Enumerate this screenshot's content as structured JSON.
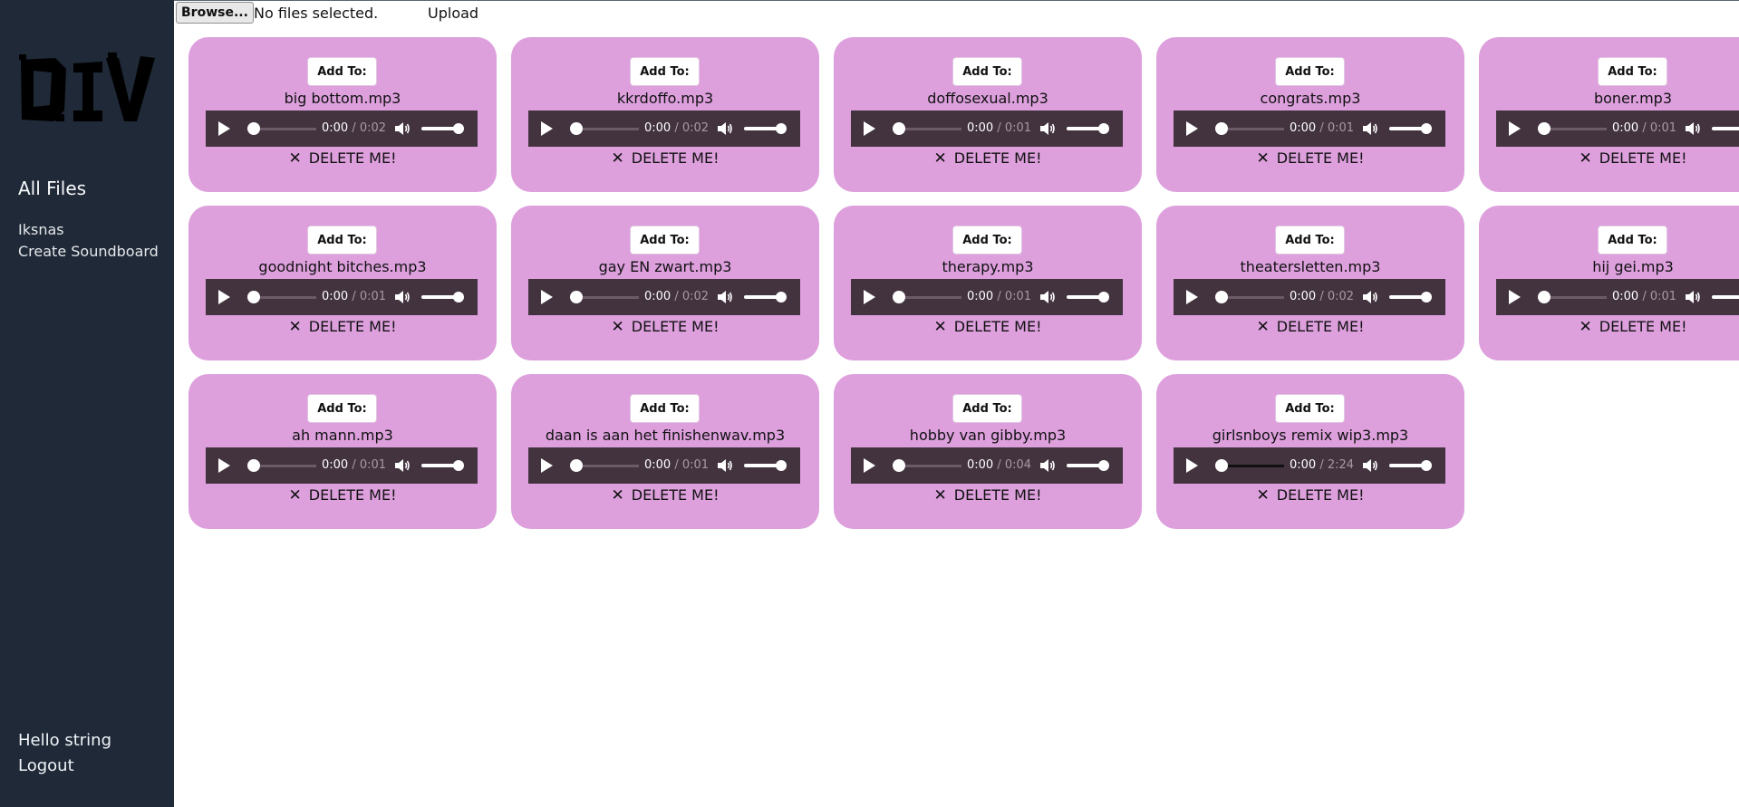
{
  "sidebar": {
    "logo_text": "DIV",
    "all_files": "All Files",
    "items": [
      {
        "label": "Iksnas"
      },
      {
        "label": "Create Soundboard"
      }
    ],
    "greeting": "Hello string",
    "logout": "Logout",
    "background": "#1f2937"
  },
  "upload": {
    "browse_label": "Browse...",
    "status": "No files selected.",
    "upload_label": "Upload"
  },
  "card_color": "#dda0dd",
  "files": [
    {
      "add_label": "Add To:",
      "name": "big bottom.mp3",
      "current": "0:00",
      "duration": "0:02",
      "delete_icon": "✕",
      "delete_label": "DELETE ME!"
    },
    {
      "add_label": "Add To:",
      "name": "kkrdoffo.mp3",
      "current": "0:00",
      "duration": "0:02",
      "delete_icon": "✕",
      "delete_label": "DELETE ME!"
    },
    {
      "add_label": "Add To:",
      "name": "doffosexual.mp3",
      "current": "0:00",
      "duration": "0:01",
      "delete_icon": "✕",
      "delete_label": "DELETE ME!"
    },
    {
      "add_label": "Add To:",
      "name": "congrats.mp3",
      "current": "0:00",
      "duration": "0:01",
      "delete_icon": "✕",
      "delete_label": "DELETE ME!"
    },
    {
      "add_label": "Add To:",
      "name": "boner.mp3",
      "current": "0:00",
      "duration": "0:01",
      "delete_icon": "✕",
      "delete_label": "DELETE ME!"
    },
    {
      "add_label": "Add To:",
      "name": "goodnight bitches.mp3",
      "current": "0:00",
      "duration": "0:01",
      "delete_icon": "✕",
      "delete_label": "DELETE ME!"
    },
    {
      "add_label": "Add To:",
      "name": "gay EN zwart.mp3",
      "current": "0:00",
      "duration": "0:02",
      "delete_icon": "✕",
      "delete_label": "DELETE ME!"
    },
    {
      "add_label": "Add To:",
      "name": "therapy.mp3",
      "current": "0:00",
      "duration": "0:01",
      "delete_icon": "✕",
      "delete_label": "DELETE ME!"
    },
    {
      "add_label": "Add To:",
      "name": "theatersletten.mp3",
      "current": "0:00",
      "duration": "0:02",
      "delete_icon": "✕",
      "delete_label": "DELETE ME!"
    },
    {
      "add_label": "Add To:",
      "name": "hij gei.mp3",
      "current": "0:00",
      "duration": "0:01",
      "delete_icon": "✕",
      "delete_label": "DELETE ME!"
    },
    {
      "add_label": "Add To:",
      "name": "ah mann.mp3",
      "current": "0:00",
      "duration": "0:01",
      "delete_icon": "✕",
      "delete_label": "DELETE ME!"
    },
    {
      "add_label": "Add To:",
      "name": "daan is aan het finishenwav.mp3",
      "current": "0:00",
      "duration": "0:01",
      "delete_icon": "✕",
      "delete_label": "DELETE ME!"
    },
    {
      "add_label": "Add To:",
      "name": "hobby van gibby.mp3",
      "current": "0:00",
      "duration": "0:04",
      "delete_icon": "✕",
      "delete_label": "DELETE ME!"
    },
    {
      "add_label": "Add To:",
      "name": "girlsnboys remix wip3.mp3",
      "current": "0:00",
      "duration": "2:24",
      "delete_icon": "✕",
      "delete_label": "DELETE ME!"
    }
  ]
}
